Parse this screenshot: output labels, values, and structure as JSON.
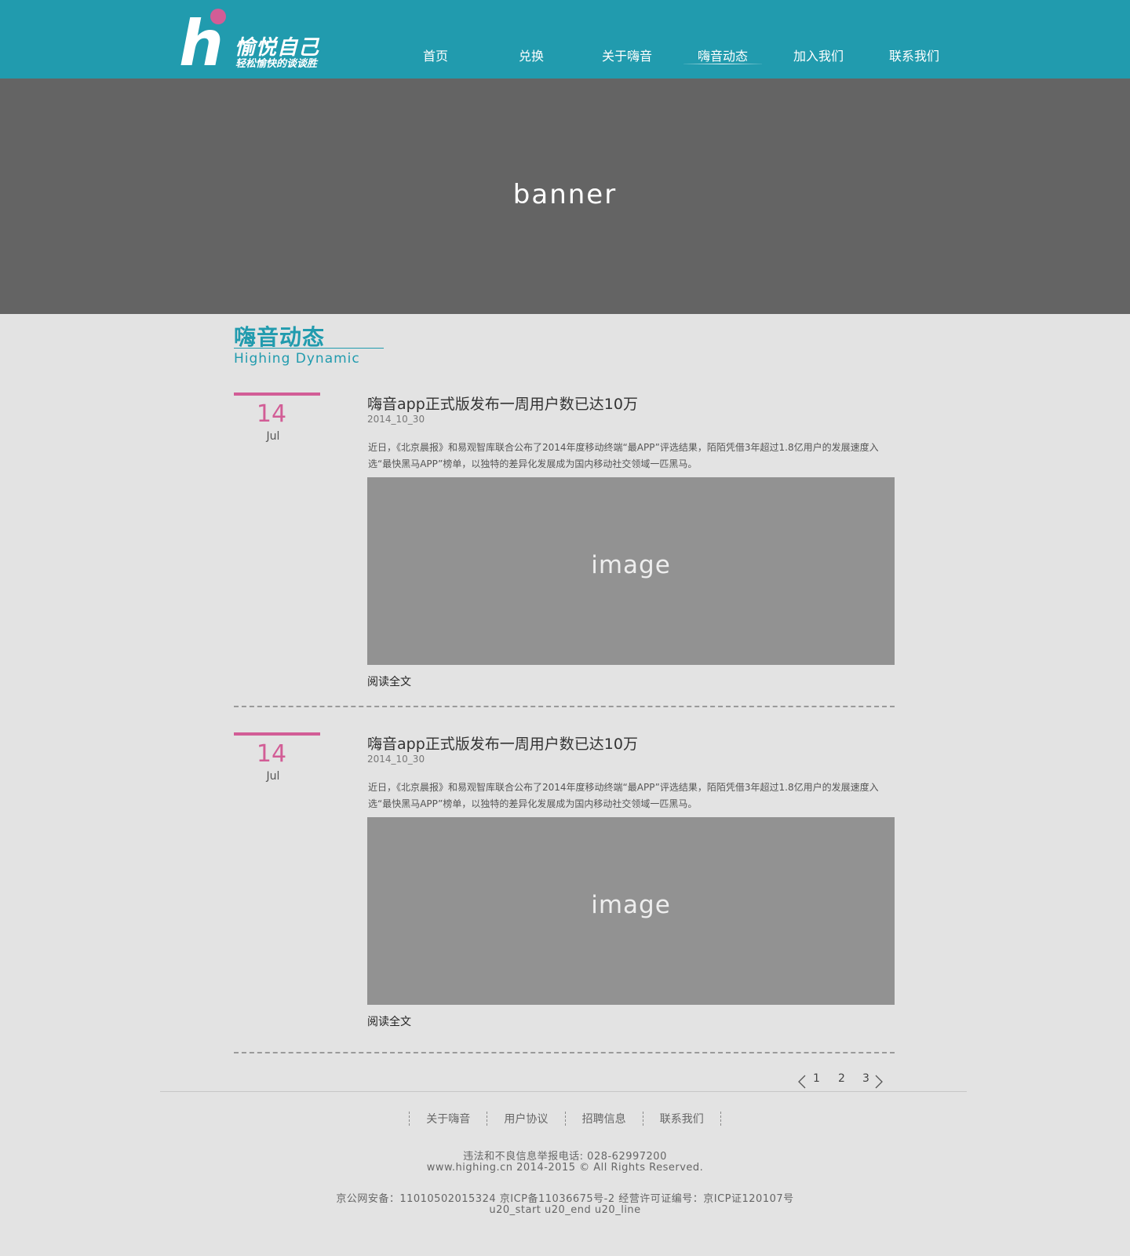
{
  "header": {
    "logo_letter": "h",
    "logo_name": "愉悦自己",
    "logo_slogan": "轻松愉快的谈谈胜",
    "nav": [
      {
        "label": "首页"
      },
      {
        "label": "兑换"
      },
      {
        "label": "关于嗨音"
      },
      {
        "label": "嗨音动态",
        "active": true
      },
      {
        "label": "加入我们"
      },
      {
        "label": "联系我们"
      }
    ]
  },
  "banner": {
    "label": "banner"
  },
  "section": {
    "title": "嗨音动态",
    "subtitle": "Highing  Dynamic"
  },
  "articles": [
    {
      "day": "14",
      "month": "Jul",
      "title": "嗨音app正式版发布一周用户数已达10万",
      "date": "2014_10_30",
      "summary": "近日，《北京晨报》和易观智库联合公布了2014年度移动终端“最APP”评选结果，陌陌凭借3年超过1.8亿用户的发展速度入选“最快黑马APP”榜单，以独特的差异化发展成为国内移动社交领域一匹黑马。",
      "image_label": "image",
      "read_more": "阅读全文"
    },
    {
      "day": "14",
      "month": "Jul",
      "title": "嗨音app正式版发布一周用户数已达10万",
      "date": "2014_10_30",
      "summary": "近日，《北京晨报》和易观智库联合公布了2014年度移动终端“最APP”评选结果，陌陌凭借3年超过1.8亿用户的发展速度入选“最快黑马APP”榜单，以独特的差异化发展成为国内移动社交领域一匹黑马。",
      "image_label": "image",
      "read_more": "阅读全文"
    }
  ],
  "pagination": {
    "pages": [
      "1",
      "2",
      "3"
    ],
    "prev_icon": "chevron-left-icon",
    "next_icon": "chevron-right-icon"
  },
  "footer": {
    "links": [
      "关于嗨音",
      "用户协议",
      "招聘信息",
      "联系我们"
    ],
    "report_line": "违法和不良信息举报电话: 028-62997200",
    "copyright": "www.highing.cn 2014-2015 © All Rights Reserved.",
    "icp_line": "京公网安备：11010502015324 京ICP备11036675号-2 经营许可证编号：京ICP证120107号",
    "extra_line": "u20_start u20_end u20_line"
  },
  "colors": {
    "header": "#219bae",
    "accent": "#d25d96",
    "banner": "#646464",
    "image": "#929292",
    "page": "#e3e3e3"
  }
}
